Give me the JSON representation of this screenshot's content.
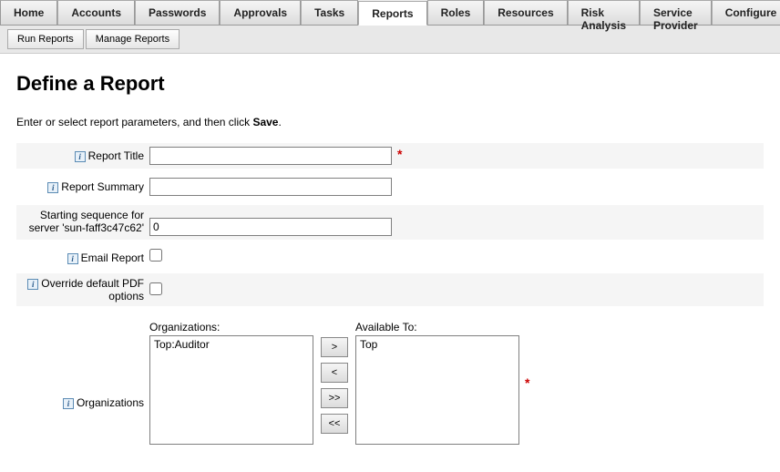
{
  "tabs": {
    "items": [
      "Home",
      "Accounts",
      "Passwords",
      "Approvals",
      "Tasks",
      "Reports",
      "Roles",
      "Resources",
      "Risk Analysis",
      "Service Provider",
      "Configure"
    ],
    "active_index": 5
  },
  "subtabs": {
    "items": [
      "Run Reports",
      "Manage Reports"
    ]
  },
  "page": {
    "title": "Define a Report",
    "instruction_prefix": "Enter or select report parameters, and then click ",
    "instruction_bold": "Save",
    "instruction_suffix": "."
  },
  "form": {
    "report_title": {
      "label": "Report Title",
      "value": ""
    },
    "report_summary": {
      "label": "Report Summary",
      "value": ""
    },
    "start_seq": {
      "label": "Starting sequence for server 'sun-faff3c47c62'",
      "value": "0"
    },
    "email_report": {
      "label": "Email Report"
    },
    "override_pdf": {
      "label": "Override default PDF options"
    },
    "organizations": {
      "label": "Organizations",
      "left_header": "Organizations:",
      "left_items": [
        "Top:Auditor"
      ],
      "right_header": "Available To:",
      "right_items": [
        "Top"
      ],
      "buttons": {
        "add": ">",
        "remove": "<",
        "add_all": ">>",
        "remove_all": "<<"
      }
    }
  }
}
